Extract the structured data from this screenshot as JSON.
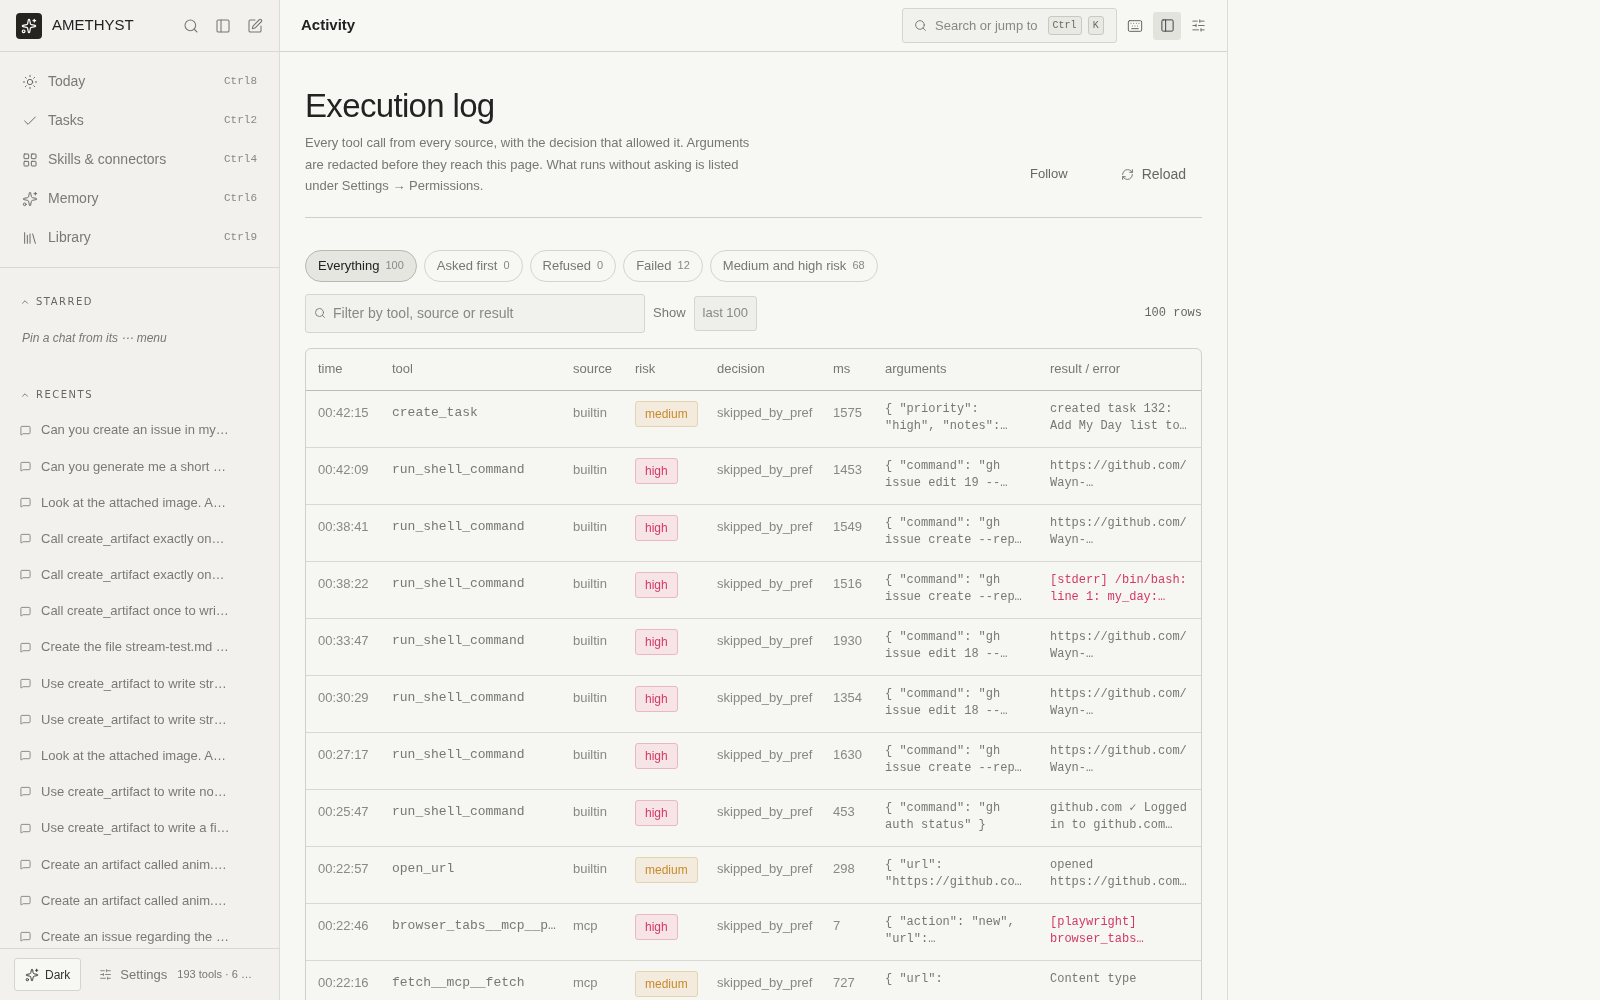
{
  "app": {
    "name": "AMETHYST"
  },
  "nav": [
    {
      "label": "Today",
      "shortcut": "Ctrl8",
      "kind": "sun"
    },
    {
      "label": "Tasks",
      "shortcut": "Ctrl2",
      "kind": "check"
    },
    {
      "label": "Skills & connectors",
      "shortcut": "Ctrl4",
      "kind": "grid"
    },
    {
      "label": "Memory",
      "shortcut": "Ctrl6",
      "kind": "sparkle"
    },
    {
      "label": "Library",
      "shortcut": "Ctrl9",
      "kind": "books"
    }
  ],
  "starred": {
    "title": "STARRED",
    "expanded": true,
    "empty_hint": "Pin a chat from its ⋯ menu"
  },
  "recents": {
    "title": "RECENTS",
    "expanded": true,
    "items": [
      "Can you create an issue in my…",
      "Can you generate me a short …",
      "Look at the attached image. A…",
      "Call create_artifact exactly on…",
      "Call create_artifact exactly on…",
      "Call create_artifact once to wri…",
      "Create the file stream-test.md …",
      "Use create_artifact to write str…",
      "Use create_artifact to write str…",
      "Look at the attached image. A…",
      "Use create_artifact to write no…",
      "Use create_artifact to write a fi…",
      "Create an artifact called anim.…",
      "Create an artifact called anim.…",
      "Create an issue regarding the …"
    ]
  },
  "footer": {
    "theme_button": "Dark",
    "settings": "Settings",
    "summary": "193 tools · 6 …"
  },
  "header": {
    "title": "Activity",
    "search_placeholder": "Search or jump to",
    "keys": [
      "Ctrl",
      "K"
    ],
    "sidebar_toggle_on": true
  },
  "page": {
    "title": "Execution log",
    "description": "Every tool call from every source, with the decision that allowed it. Arguments are redacted before they reach this page. What runs without asking is listed under Settings → Permissions.",
    "follow": "Follow",
    "reload": "Reload"
  },
  "filters": [
    {
      "label": "Everything",
      "count": "100",
      "selected": true
    },
    {
      "label": "Asked first",
      "count": "0",
      "selected": false
    },
    {
      "label": "Refused",
      "count": "0",
      "selected": false
    },
    {
      "label": "Failed",
      "count": "12",
      "selected": false
    },
    {
      "label": "Medium and high risk",
      "count": "68",
      "selected": false
    }
  ],
  "filter_field": {
    "placeholder": "Filter by tool, source or result"
  },
  "show": {
    "label": "Show",
    "value": "last 100"
  },
  "row_count": "100 rows",
  "table": {
    "columns": [
      "time",
      "tool",
      "source",
      "risk",
      "decision",
      "ms",
      "arguments",
      "result / error"
    ],
    "rows": [
      {
        "time": "00:42:15",
        "tool": "create_task",
        "source": "builtin",
        "risk": "medium",
        "decision": "skipped_by_pref",
        "ms": "1575",
        "arguments": [
          "{ \"priority\":",
          "\"high\", \"notes\":…"
        ],
        "result": [
          "created task 132:",
          "Add My Day list to…"
        ],
        "error": false
      },
      {
        "time": "00:42:09",
        "tool": "run_shell_command",
        "source": "builtin",
        "risk": "high",
        "decision": "skipped_by_pref",
        "ms": "1453",
        "arguments": [
          "{ \"command\": \"gh",
          "issue edit 19 --…"
        ],
        "result": [
          "https://github.com/",
          "Wayn-…"
        ],
        "error": false
      },
      {
        "time": "00:38:41",
        "tool": "run_shell_command",
        "source": "builtin",
        "risk": "high",
        "decision": "skipped_by_pref",
        "ms": "1549",
        "arguments": [
          "{ \"command\": \"gh",
          "issue create --rep…"
        ],
        "result": [
          "https://github.com/",
          "Wayn-…"
        ],
        "error": false
      },
      {
        "time": "00:38:22",
        "tool": "run_shell_command",
        "source": "builtin",
        "risk": "high",
        "decision": "skipped_by_pref",
        "ms": "1516",
        "arguments": [
          "{ \"command\": \"gh",
          "issue create --rep…"
        ],
        "result": [
          "[stderr] /bin/bash:",
          "line 1: my_day:…"
        ],
        "error": true
      },
      {
        "time": "00:33:47",
        "tool": "run_shell_command",
        "source": "builtin",
        "risk": "high",
        "decision": "skipped_by_pref",
        "ms": "1930",
        "arguments": [
          "{ \"command\": \"gh",
          "issue edit 18 --…"
        ],
        "result": [
          "https://github.com/",
          "Wayn-…"
        ],
        "error": false
      },
      {
        "time": "00:30:29",
        "tool": "run_shell_command",
        "source": "builtin",
        "risk": "high",
        "decision": "skipped_by_pref",
        "ms": "1354",
        "arguments": [
          "{ \"command\": \"gh",
          "issue edit 18 --…"
        ],
        "result": [
          "https://github.com/",
          "Wayn-…"
        ],
        "error": false
      },
      {
        "time": "00:27:17",
        "tool": "run_shell_command",
        "source": "builtin",
        "risk": "high",
        "decision": "skipped_by_pref",
        "ms": "1630",
        "arguments": [
          "{ \"command\": \"gh",
          "issue create --rep…"
        ],
        "result": [
          "https://github.com/",
          "Wayn-…"
        ],
        "error": false
      },
      {
        "time": "00:25:47",
        "tool": "run_shell_command",
        "source": "builtin",
        "risk": "high",
        "decision": "skipped_by_pref",
        "ms": "453",
        "arguments": [
          "{ \"command\": \"gh",
          "auth status\" }"
        ],
        "result": [
          "github.com ✓ Logged",
          "in to github.com…"
        ],
        "error": false
      },
      {
        "time": "00:22:57",
        "tool": "open_url",
        "source": "builtin",
        "risk": "medium",
        "decision": "skipped_by_pref",
        "ms": "298",
        "arguments": [
          "{ \"url\":",
          "\"https://github.co…"
        ],
        "result": [
          "opened",
          "https://github.com…"
        ],
        "error": false
      },
      {
        "time": "00:22:46",
        "tool": "browser_tabs__mcp__p…",
        "source": "mcp",
        "risk": "high",
        "decision": "skipped_by_pref",
        "ms": "7",
        "arguments": [
          "{ \"action\": \"new\",",
          "\"url\":…"
        ],
        "result": [
          "[playwright]",
          "browser_tabs…"
        ],
        "error": true
      },
      {
        "time": "00:22:16",
        "tool": "fetch__mcp__fetch",
        "source": "mcp",
        "risk": "medium",
        "decision": "skipped_by_pref",
        "ms": "727",
        "arguments": [
          "{ \"url\":"
        ],
        "result": [
          "Content type"
        ],
        "error": false
      }
    ]
  }
}
